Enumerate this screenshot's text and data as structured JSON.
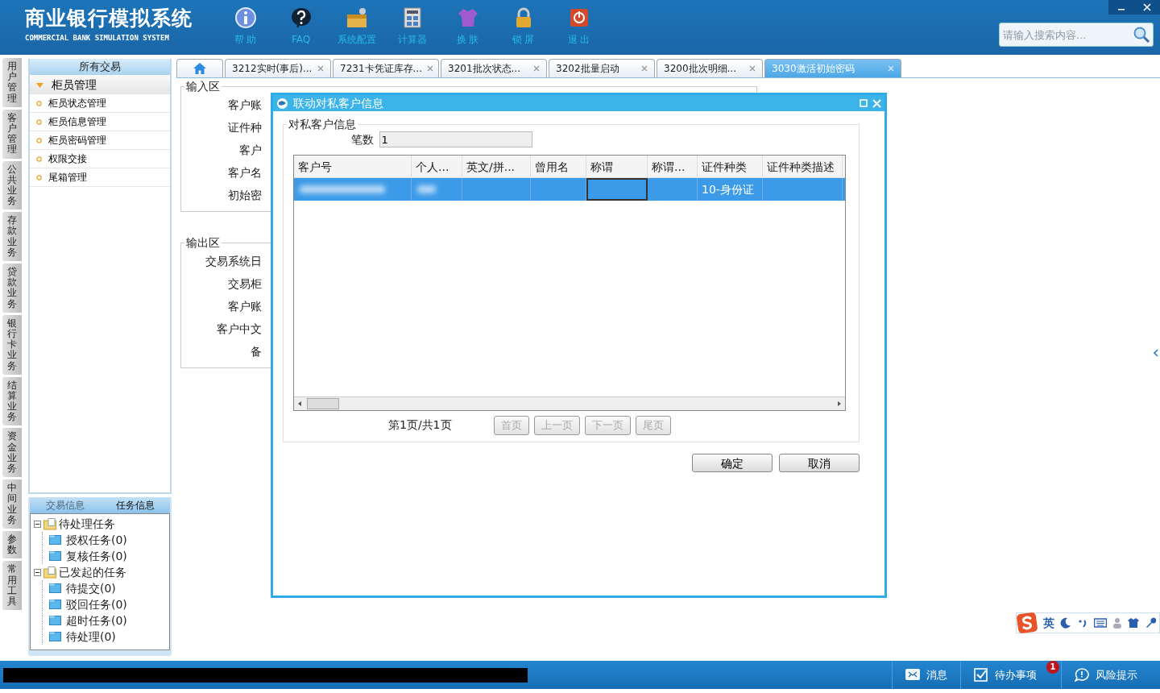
{
  "header": {
    "title": "商业银行模拟系统",
    "subtitle": "COMMERCIAL BANK SIMULATION SYSTEM",
    "tools": [
      {
        "kind": "info",
        "label": "帮 助"
      },
      {
        "kind": "faq",
        "label": "FAQ"
      },
      {
        "kind": "config",
        "label": "系统配置"
      },
      {
        "kind": "calculator",
        "label": "计算器"
      },
      {
        "kind": "skin",
        "label": "换 肤"
      },
      {
        "kind": "lock",
        "label": "锁 屏"
      },
      {
        "kind": "exit",
        "label": "退 出"
      }
    ],
    "search": {
      "placeholder": "请输入搜索内容..."
    }
  },
  "side_tabs": [
    {
      "label": "用户管理"
    },
    {
      "label": "客户管理"
    },
    {
      "label": "公共业务"
    },
    {
      "label": "存款业务"
    },
    {
      "label": "贷款业务"
    },
    {
      "label": "银行卡业务"
    },
    {
      "label": "结算业务"
    },
    {
      "label": "资金业务"
    },
    {
      "label": "中间业务"
    },
    {
      "label": "参数"
    },
    {
      "label": "常用工具"
    }
  ],
  "sidebar": {
    "title": "所有交易",
    "groups": [
      {
        "label": "柜员管理",
        "expanded": true,
        "children": [
          {
            "label": "柜员状态管理"
          },
          {
            "label": "柜员信息管理"
          },
          {
            "label": "柜员密码管理"
          },
          {
            "label": "权限交接"
          },
          {
            "label": "尾箱管理"
          }
        ]
      }
    ]
  },
  "task_panel": {
    "tabs": [
      {
        "label": "交易信息",
        "selected": false
      },
      {
        "label": "任务信息",
        "selected": true
      }
    ],
    "tree": [
      {
        "label": "待处理任务",
        "expanded": true,
        "children": [
          {
            "label": "授权任务(0)"
          },
          {
            "label": "复核任务(0)"
          }
        ]
      },
      {
        "label": "已发起的任务",
        "expanded": true,
        "children": [
          {
            "label": "待提交(0)"
          },
          {
            "label": "驳回任务(0)"
          },
          {
            "label": "超时任务(0)"
          },
          {
            "label": "待处理(0)"
          }
        ]
      }
    ]
  },
  "tabs": [
    {
      "kind": "home",
      "selected": false
    },
    {
      "kind": "page",
      "label": "3212实时(事后)...",
      "selected": false
    },
    {
      "kind": "page",
      "label": "7231卡凭证库存...",
      "selected": false
    },
    {
      "kind": "page",
      "label": "3201批次状态...",
      "selected": false
    },
    {
      "kind": "page",
      "label": "3202批量启动",
      "selected": false
    },
    {
      "kind": "page",
      "label": "3200批次明细...",
      "selected": false
    },
    {
      "kind": "page",
      "label": "3030激活初始密码",
      "selected": true
    }
  ],
  "form": {
    "input_legend": "输入区",
    "input_labels": [
      "客户账",
      "证件种",
      "客户",
      "客户名",
      "初始密"
    ],
    "output_legend": "输出区",
    "output_labels": [
      "交易系统日",
      "交易柜",
      "客户账",
      "客户中文",
      "备"
    ]
  },
  "dialog": {
    "title": "联动对私客户信息",
    "legend": "对私客户信息",
    "count_label": "笔数",
    "count_value": "1",
    "columns": [
      "客户号",
      "个人...",
      "英文/拼...",
      "曾用名",
      "称谓",
      "称谓...",
      "证件种类",
      "证件种类描述"
    ],
    "rows": [
      {
        "selected": true,
        "cells": [
          {
            "kind": "blurred",
            "focused": false
          },
          {
            "kind": "blurred",
            "focused": false
          },
          {
            "kind": "empty",
            "focused": false
          },
          {
            "kind": "empty",
            "focused": false
          },
          {
            "kind": "empty",
            "focused": true
          },
          {
            "kind": "empty",
            "focused": false
          },
          {
            "kind": "text",
            "text": "10-身份证",
            "focused": false
          },
          {
            "kind": "empty",
            "focused": false
          }
        ]
      }
    ],
    "pager": {
      "info": "第1页/共1页",
      "buttons": [
        {
          "label": "首页",
          "disabled": true
        },
        {
          "label": "上一页",
          "disabled": true
        },
        {
          "label": "下一页",
          "disabled": true
        },
        {
          "label": "尾页",
          "disabled": true
        }
      ]
    },
    "actions": [
      "确定",
      "取消"
    ]
  },
  "ime_bar": {
    "mode": "英"
  },
  "status_bar": {
    "items": [
      {
        "kind": "mail",
        "label": "消息"
      },
      {
        "kind": "todo",
        "label": "待办事项",
        "badge": "1"
      },
      {
        "kind": "chat",
        "label": "风险提示"
      }
    ]
  }
}
